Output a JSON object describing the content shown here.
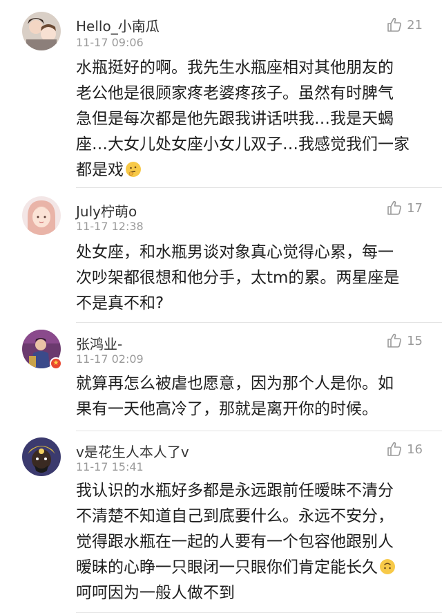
{
  "comments": [
    {
      "username": "Hello_小南瓜",
      "time": "11-17 09:06",
      "likes": "21",
      "lines": [
        "水瓶挺好的啊。我先生水瓶座相对其他朋友的",
        "老公他是很顾家疼老婆疼孩子。虽然有时脾气",
        "急但是每次都是他先跟我讲话哄我…我是天蝎",
        "座…大女儿处女座小女儿双子…我感觉我们一家",
        "都是戏"
      ],
      "emoji": "thinking-face"
    },
    {
      "username": "July柠萌o",
      "time": "11-17 12:38",
      "likes": "17",
      "lines": [
        "处女座，和水瓶男谈对象真心觉得心累，每一",
        "次吵架都很想和他分手，太tm的累。两星座是",
        "不是真不和?"
      ]
    },
    {
      "username": "张鸿业-",
      "time": "11-17 02:09",
      "likes": "15",
      "lines": [
        "就算再怎么被虐也愿意，因为那个人是你。如",
        "果有一天他高冷了，那就是离开你的时候。"
      ]
    },
    {
      "username": "v是花生人本人了v",
      "time": "11-17 15:41",
      "likes": "16",
      "lines": [
        "我认识的水瓶好多都是永远跟前任暧昧不清分",
        "不清楚不知道自己到底要什么。永远不安分，",
        "觉得跟水瓶在一起的人要有一个包容他跟别人",
        "暧昧的心睁一只眼闭一只眼你们肯定能长久",
        "呵呵因为一般人做不到"
      ],
      "emoji": "upside-down-face"
    }
  ],
  "colors": {
    "username": "#333333",
    "time": "#9a9a9a",
    "text": "#1f1f1f",
    "divider": "#e3e3e3",
    "badge": "#e8462f"
  },
  "icons": {
    "like": "thumbs-up-outline-icon",
    "badge": "star-badge-icon"
  }
}
